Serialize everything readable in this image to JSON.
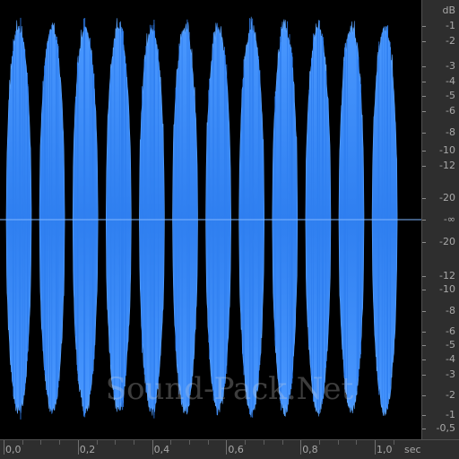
{
  "colors": {
    "waveform": "#2f7ff0",
    "waveform_edge": "#5aa4ff",
    "background": "#000000",
    "ruler_bg": "#2e2e2e",
    "ruler_text": "#a8a8a8",
    "centerline": "#7fb6ff"
  },
  "db_scale": {
    "unit": "dB",
    "labels": [
      "-1",
      "-2",
      "-3",
      "-4",
      "-5",
      "-6",
      "-8",
      "-10",
      "-12",
      "-20",
      "-∞",
      "-20",
      "-12",
      "-10",
      "-8",
      "-6",
      "-5",
      "-4",
      "-3",
      "-2",
      "-1",
      "-0,5"
    ]
  },
  "time_scale": {
    "unit": "sec",
    "labels": [
      "0,0",
      "0,2",
      "0,4",
      "0,6",
      "0,8",
      "1,0"
    ]
  },
  "waveform": {
    "channels": 1,
    "burst_count": 12,
    "length_sec": 1.1
  },
  "watermark": {
    "text": "Sound-Pack.Net"
  }
}
